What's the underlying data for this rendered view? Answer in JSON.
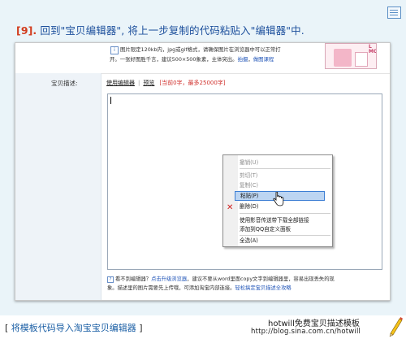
{
  "step": {
    "number": "[9].",
    "text": " 回到\"宝贝编辑器\", 将上一步复制的代码粘贴入\"编辑器\"中."
  },
  "image_info": {
    "line1": "图片限定120kb内，jpg或gif格式，请确保图片在浏览器中可以正常打",
    "line2_prefix": "开。一张好图胜千言，建议500×500象素，主体突出。",
    "link_shoot": "拍摄",
    "link_sep": "，",
    "link_tutorial": "做图课程",
    "thumb_text": "L MODEL"
  },
  "form": {
    "field_label": "宝贝描述:",
    "tab_editor": "使用编辑器",
    "tab_sep": "|",
    "tab_preview": "预览",
    "char_count": "[当前0字，最多25000字]"
  },
  "context_menu": {
    "items": [
      {
        "label": "撤销(U)",
        "disabled": true
      },
      {
        "label": "剪切(T)",
        "disabled": true
      },
      {
        "label": "复制(C)",
        "disabled": true
      },
      {
        "label": "粘贴(P)",
        "disabled": false,
        "selected": true
      },
      {
        "label": "删除(D)",
        "disabled": false
      },
      {
        "label": "使用影音传送带下载全部链接",
        "disabled": false
      },
      {
        "label": "添加到QQ自定义面板",
        "disabled": false
      },
      {
        "label": "全选(A)",
        "disabled": false
      }
    ]
  },
  "bottom_note": {
    "line1_a": "看不到编辑器？",
    "line1_link": "点击升级浏览器",
    "line1_b": "，建议不要从word里面copy文字到编辑器里，容易出现丢失的现",
    "line2_a": "象。描述里的图片需要先上传哦，可添加淘宝内部连接。",
    "line2_link": "轻松搞定宝贝描述全攻略"
  },
  "footer": {
    "title_left": "[",
    "title": " 将模板代码导入淘宝宝贝编辑器 ",
    "title_right": "]",
    "brand": "hotwill免费宝贝描述模板",
    "url": "http://blog.sina.com.cn/hotwill"
  },
  "colors": {
    "step_text": "#1c4f9c",
    "step_number": "#d23c1e",
    "footer_title": "#1b5fa5",
    "menu_highlight": "#bcd5f2",
    "count_red": "#d0302c"
  }
}
